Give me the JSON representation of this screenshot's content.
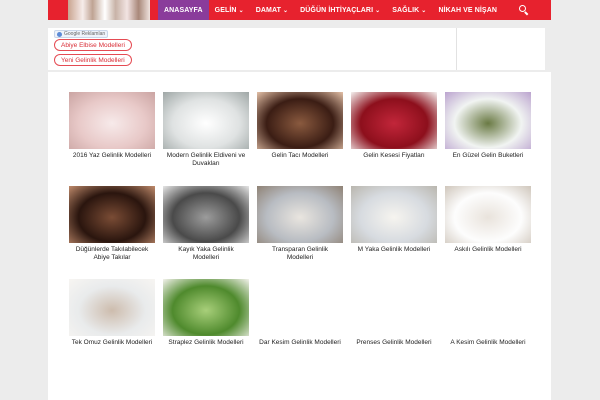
{
  "nav": {
    "items": [
      {
        "label": "ANASAYFA",
        "active": true,
        "dropdown": false
      },
      {
        "label": "GELİN",
        "active": false,
        "dropdown": true
      },
      {
        "label": "DAMAT",
        "active": false,
        "dropdown": true
      },
      {
        "label": "DÜĞÜN İHTİYAÇLARI",
        "active": false,
        "dropdown": true
      },
      {
        "label": "SAĞLIK",
        "active": false,
        "dropdown": true
      },
      {
        "label": "NİKAH VE NİŞAN",
        "active": false,
        "dropdown": false
      }
    ],
    "caret": "⌄",
    "search_icon": "search-icon"
  },
  "ads": {
    "label": "Google Reklamları",
    "links": [
      "Abiye Elbise Modelleri",
      "Yeni Gelinlik Modelleri"
    ]
  },
  "grid": [
    {
      "caption": "2016 Yaz Gelinlik Modelleri",
      "colors": [
        "#e8c9c8",
        "#f7eaea",
        "#caa4a2"
      ]
    },
    {
      "caption": "Modern Gelinlik Eldiveni ve Duvakları",
      "colors": [
        "#dfe2e2",
        "#ffffff",
        "#9fa7a6"
      ]
    },
    {
      "caption": "Gelin Tacı Modelleri",
      "colors": [
        "#3b1d14",
        "#8a5a3f",
        "#e3c0a7"
      ]
    },
    {
      "caption": "Gelin Kesesi Fiyatları",
      "colors": [
        "#8d0f1c",
        "#c2263a",
        "#f4f1ef"
      ]
    },
    {
      "caption": "En Güzel Gelin Buketleri",
      "colors": [
        "#f1f4f2",
        "#6a7a44",
        "#bba3cf"
      ]
    },
    {
      "caption": "Düğünlerde Takılabilecek Abiye Takılar",
      "colors": [
        "#2a150e",
        "#7a4c35",
        "#c08b6c"
      ]
    },
    {
      "caption": "Kayık Yaka Gelinlik Modelleri",
      "colors": [
        "#4a4a4a",
        "#9c9c9c",
        "#e6e6e6"
      ]
    },
    {
      "caption": "Transparan Gelinlik Modelleri",
      "colors": [
        "#b8bcc2",
        "#e9e5df",
        "#8f8275"
      ]
    },
    {
      "caption": "M Yaka Gelinlik Modelleri",
      "colors": [
        "#d7dbe0",
        "#f6f4ef",
        "#b9b6ae"
      ]
    },
    {
      "caption": "Askılı Gelinlik Modelleri",
      "colors": [
        "#fdfdfd",
        "#e9e3dc",
        "#cfc6bb"
      ]
    },
    {
      "caption": "Tek Omuz Gelinlik Modelleri",
      "colors": [
        "#e9ebec",
        "#cdbcad",
        "#f7f5f2"
      ]
    },
    {
      "caption": "Straplez Gelinlik Modelleri",
      "colors": [
        "#4f8a2d",
        "#a8cf7a",
        "#f3f2ec"
      ]
    },
    {
      "caption": "Dar Kesim Gelinlik Modelleri",
      "colors": []
    },
    {
      "caption": "Prenses Gelinlik Modelleri",
      "colors": []
    },
    {
      "caption": "A Kesim Gelinlik Modelleri",
      "colors": []
    }
  ]
}
